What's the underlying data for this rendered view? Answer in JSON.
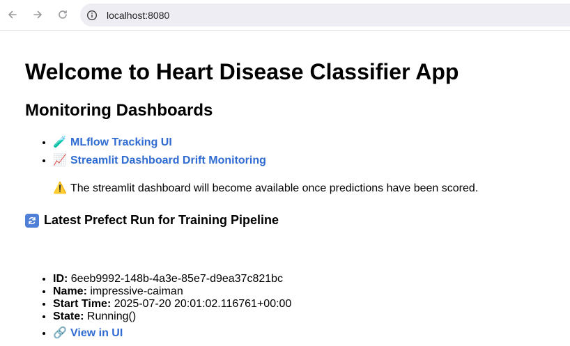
{
  "browser": {
    "url": "localhost:8080"
  },
  "page": {
    "title": "Welcome to Heart Disease Classifier App",
    "section_title": "Monitoring Dashboards",
    "dashboards": [
      {
        "emoji": "🧪",
        "label": "MLflow Tracking UI"
      },
      {
        "emoji": "📈",
        "label": "Streamlit Dashboard Drift Monitoring"
      }
    ],
    "notice": {
      "emoji": "⚠️",
      "text": "The streamlit dashboard will become available once predictions have been scored."
    },
    "run_section_title": "Latest Prefect Run for Training Pipeline",
    "run": {
      "id_label": "ID:",
      "id_value": "6eeb9992-148b-4a3e-85e7-d9ea37c821bc",
      "name_label": "Name:",
      "name_value": "impressive-caiman",
      "start_label": "Start Time:",
      "start_value": "2025-07-20 20:01:02.116761+00:00",
      "state_label": "State:",
      "state_value": "Running()",
      "view_emoji": "🔗",
      "view_label": "View in UI"
    }
  }
}
